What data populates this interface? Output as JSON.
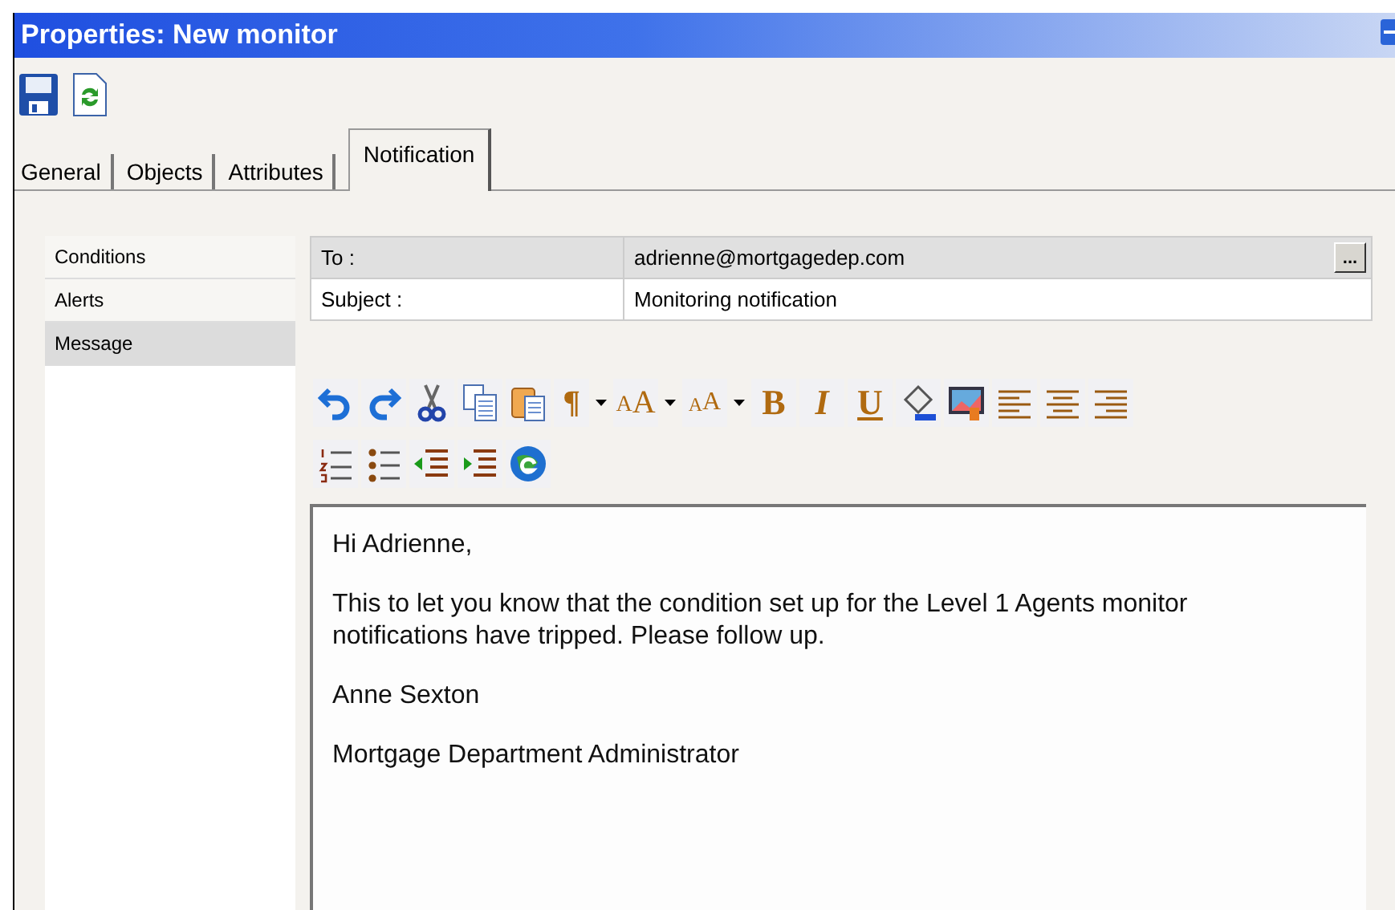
{
  "window": {
    "title": "Properties: New monitor"
  },
  "tabs": [
    {
      "label": "General",
      "selected": false
    },
    {
      "label": "Objects",
      "selected": false
    },
    {
      "label": "Attributes",
      "selected": false
    },
    {
      "label": "Notification",
      "selected": true
    }
  ],
  "sidebar": {
    "items": [
      {
        "label": "Conditions",
        "selected": false
      },
      {
        "label": "Alerts",
        "selected": false
      },
      {
        "label": "Message",
        "selected": true
      }
    ]
  },
  "fields": [
    {
      "label": "To :",
      "value": "adrienne@mortgagedep.com",
      "browse_button": "..."
    },
    {
      "label": "Subject :",
      "value": "Monitoring notification"
    }
  ],
  "editor_toolbar": [
    [
      {
        "kind": "undo"
      },
      {
        "kind": "redo"
      },
      {
        "kind": "cut"
      },
      {
        "kind": "copy"
      },
      {
        "kind": "paste"
      },
      {
        "kind": "glyph",
        "text": "¶",
        "dropdown": true
      },
      {
        "kind": "fontsize",
        "text": "AA",
        "dropdown": true
      },
      {
        "kind": "fontsize_small",
        "text": "AA",
        "dropdown": true
      },
      {
        "kind": "bold",
        "text": "B"
      },
      {
        "kind": "italic",
        "text": "I"
      },
      {
        "kind": "underline",
        "text": "U"
      },
      {
        "kind": "fill"
      },
      {
        "kind": "image"
      },
      {
        "kind": "align_left"
      },
      {
        "kind": "align_center"
      },
      {
        "kind": "align_right"
      }
    ],
    [
      {
        "kind": "numbered"
      },
      {
        "kind": "bulleted"
      },
      {
        "kind": "outdent"
      },
      {
        "kind": "indent"
      },
      {
        "kind": "globe"
      }
    ]
  ],
  "message": [
    "Hi Adrienne,",
    "This to let you know that the condition set up for the Level 1 Agents monitor notifications have tripped. Please follow up.",
    "Anne Sexton",
    "Mortgage Department Administrator"
  ]
}
